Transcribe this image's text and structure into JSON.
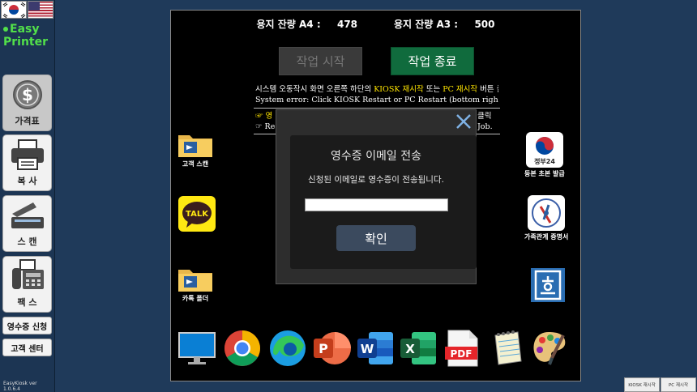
{
  "sidebar": {
    "brand_line1": "Easy",
    "brand_line2": "Printer",
    "buttons": [
      {
        "label": "가격표",
        "icon": "dollar-icon",
        "active": true
      },
      {
        "label": "복 사",
        "icon": "printer-icon"
      },
      {
        "label": "스 캔",
        "icon": "scanner-icon"
      },
      {
        "label": "팩 스",
        "icon": "fax-icon"
      }
    ],
    "receipt_request": "영수증 신청",
    "customer_center": "고객 센터",
    "version": "EasyKiosk ver 1.0.6.4"
  },
  "main": {
    "paper_a4_label": "용지 잔량 A4 :",
    "paper_a4_value": "478",
    "paper_a3_label": "용지 잔량 A3 :",
    "paper_a3_value": "500",
    "job_start": "작업 시작",
    "job_end": "작업 종료",
    "notice_ko_prefix": "시스템 오동작시 화면 오른쪽 하단의 ",
    "notice_ko_kiosk": "KIOSK 재시작",
    "notice_ko_mid": " 또는 ",
    "notice_ko_pc": "PC 재시작",
    "notice_ko_suffix": " 버튼 클릭",
    "notice_en": "System error: Click KIOSK Restart or PC Restart (bottom right)",
    "notice2_left1": "☞ 영",
    "notice2_right1": "클릭",
    "notice2_left2": "☞ Re",
    "notice2_right2": "Job.",
    "left_apps": [
      {
        "caption": "고객 스캔",
        "icon": "scan-folder-icon"
      },
      {
        "caption": "",
        "icon": "kakaotalk-icon"
      },
      {
        "caption": "카톡 폴더",
        "icon": "kakao-folder-icon"
      }
    ],
    "right_apps": [
      {
        "caption": "등본 초본 발급",
        "icon": "gov24-icon",
        "icon_text": "정부24"
      },
      {
        "caption": "가족관계 증명서",
        "icon": "family-cert-icon"
      },
      {
        "caption": "",
        "icon": "hangul-doc-icon"
      }
    ],
    "kakao_icon_text": "TALK",
    "ppt_letter": "P",
    "word_letter": "W",
    "excel_letter": "X",
    "pdf_text": "PDF",
    "dock": [
      "monitor-icon",
      "chrome-icon",
      "edge-icon",
      "powerpoint-icon",
      "word-icon",
      "excel-icon",
      "pdf-icon",
      "notepad-icon",
      "paint-icon"
    ]
  },
  "modal": {
    "title": "영수증 이메일 전송",
    "message": "신청된 이메일로 영수증이 전송됩니다.",
    "email_value": "",
    "confirm": "확인"
  },
  "taskbar": {
    "kiosk_restart": "KIOSK 재시작",
    "pc_restart": "PC 재시작"
  },
  "colors": {
    "background": "#1f3a5a",
    "brand_green": "#52e04a",
    "job_end_green": "#106b3d",
    "notice_yellow": "#ffe500"
  }
}
